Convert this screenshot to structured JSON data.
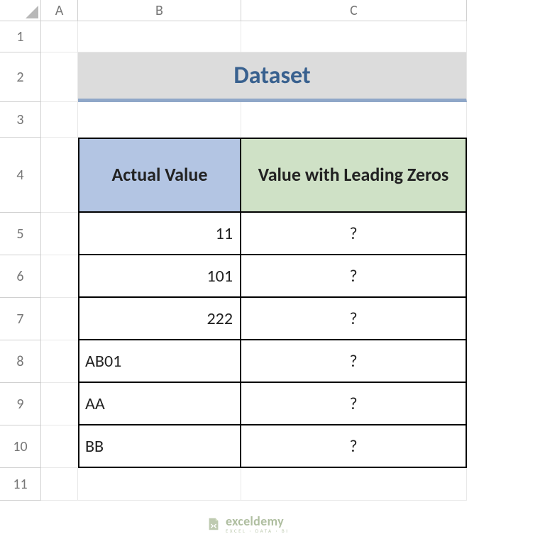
{
  "columns": {
    "A": "A",
    "B": "B",
    "C": "C"
  },
  "rows": {
    "r1": "1",
    "r2": "2",
    "r3": "3",
    "r4": "4",
    "r5": "5",
    "r6": "6",
    "r7": "7",
    "r8": "8",
    "r9": "9",
    "r10": "10",
    "r11": "11"
  },
  "title": "Dataset",
  "headers": {
    "actual": "Actual Value",
    "leading": "Value with Leading Zeros"
  },
  "data": [
    {
      "actual": "11",
      "align": "num",
      "result": "?"
    },
    {
      "actual": "101",
      "align": "num",
      "result": "?"
    },
    {
      "actual": "222",
      "align": "num",
      "result": "?"
    },
    {
      "actual": "AB01",
      "align": "txt",
      "result": "?"
    },
    {
      "actual": "AA",
      "align": "txt",
      "result": "?"
    },
    {
      "actual": "BB",
      "align": "txt",
      "result": "?"
    }
  ],
  "watermark": {
    "brand": "exceldemy",
    "tagline": "EXCEL · DATA · BI"
  }
}
